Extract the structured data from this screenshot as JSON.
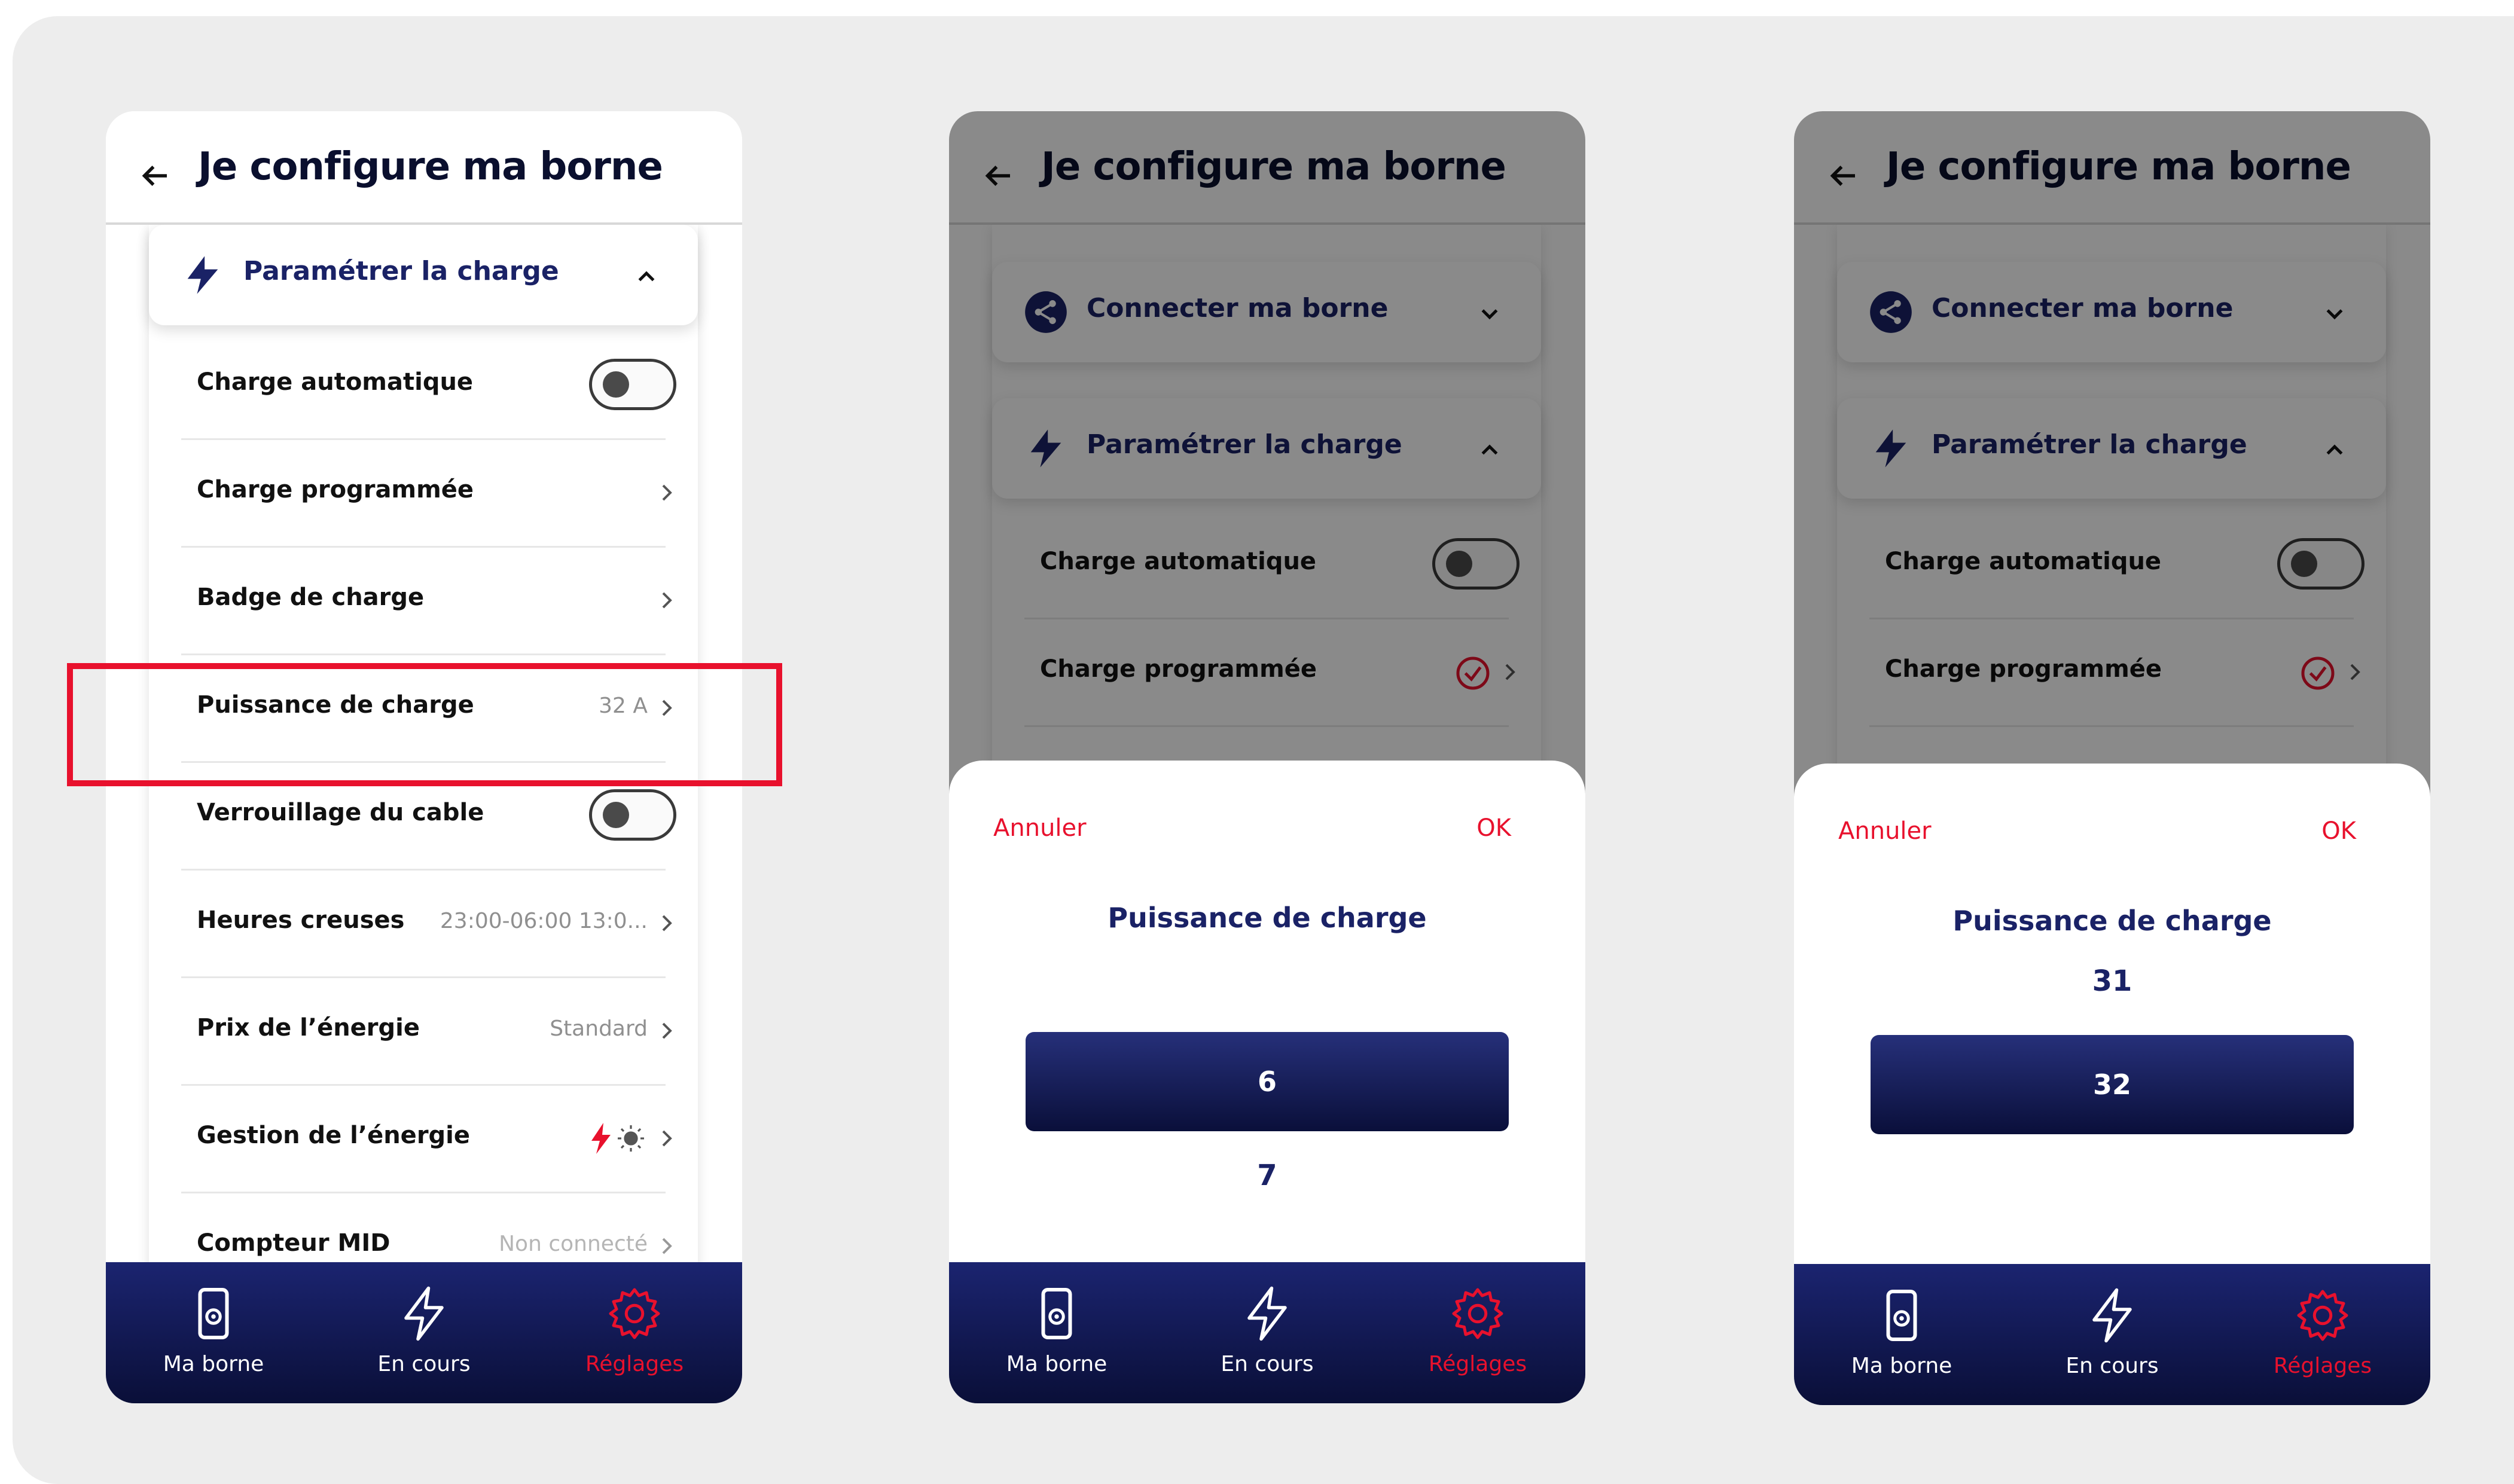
{
  "colors": {
    "accent": "#e8112d",
    "navy": "#1a2266",
    "tabbar": "#0f1650",
    "background": "#ededed"
  },
  "header": {
    "title": "Je configure ma borne",
    "back_icon": "arrow-left-icon"
  },
  "sections": {
    "connect": {
      "label": "Connecter ma borne",
      "icon": "share-icon",
      "state": "collapsed"
    },
    "charge": {
      "label": "Paramétrer la charge",
      "icon": "bolt-icon",
      "state": "expanded"
    }
  },
  "settings": [
    {
      "label": "Charge automatique",
      "control": "toggle",
      "on": false
    },
    {
      "label": "Charge programmée",
      "control": "chevron"
    },
    {
      "label": "Badge de charge",
      "control": "chevron"
    },
    {
      "label": "Puissance de charge",
      "value": "32 A",
      "control": "chevron",
      "highlighted": true
    },
    {
      "label": "Verrouillage du cable",
      "control": "toggle",
      "on": false
    },
    {
      "label": "Heures creuses",
      "value": "23:00-06:00 13:0...",
      "control": "chevron"
    },
    {
      "label": "Prix de l’énergie",
      "value": "Standard",
      "control": "chevron"
    },
    {
      "label": "Gestion de l’énergie",
      "icons": [
        "bolt-icon",
        "sun-icon"
      ],
      "control": "chevron"
    },
    {
      "label": "Compteur MID",
      "value": "Non connecté",
      "control": "chevron"
    }
  ],
  "picker_screen_2": {
    "cancel": "Annuler",
    "ok": "OK",
    "title": "Puissance de charge",
    "selected": "6",
    "below": "7"
  },
  "picker_screen_3": {
    "cancel": "Annuler",
    "ok": "OK",
    "title": "Puissance de charge",
    "above": "31",
    "selected": "32"
  },
  "tabbar": [
    {
      "label": "Ma borne",
      "icon": "charger-icon",
      "active": false
    },
    {
      "label": "En cours",
      "icon": "bolt-outline-icon",
      "active": false
    },
    {
      "label": "Réglages",
      "icon": "gear-icon",
      "active": true
    }
  ]
}
